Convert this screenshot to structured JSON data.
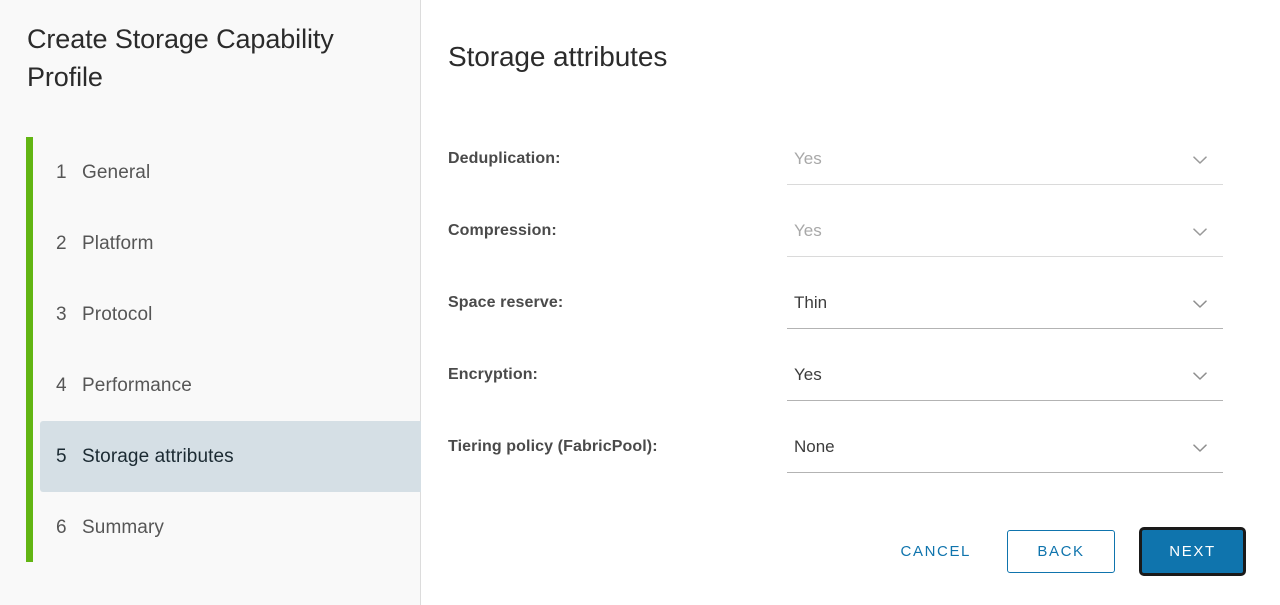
{
  "wizard": {
    "title": "Create Storage Capability Profile",
    "accent_color": "#62b513",
    "active_step_bg": "#d5dfe5",
    "steps": [
      {
        "num": "1",
        "label": "General",
        "active": false
      },
      {
        "num": "2",
        "label": "Platform",
        "active": false
      },
      {
        "num": "3",
        "label": "Protocol",
        "active": false
      },
      {
        "num": "4",
        "label": "Performance",
        "active": false
      },
      {
        "num": "5",
        "label": "Storage attributes",
        "active": true
      },
      {
        "num": "6",
        "label": "Summary",
        "active": false
      }
    ]
  },
  "page": {
    "title": "Storage attributes"
  },
  "form": {
    "fields": [
      {
        "label": "Deduplication:",
        "value": "Yes",
        "disabled": true,
        "icon": "chevron-down-icon"
      },
      {
        "label": "Compression:",
        "value": "Yes",
        "disabled": true,
        "icon": "chevron-down-icon"
      },
      {
        "label": "Space reserve:",
        "value": "Thin",
        "disabled": false,
        "icon": "chevron-down-icon"
      },
      {
        "label": "Encryption:",
        "value": "Yes",
        "disabled": false,
        "icon": "chevron-down-icon"
      },
      {
        "label": "Tiering policy (FabricPool):",
        "value": "None",
        "disabled": false,
        "icon": "chevron-down-icon"
      }
    ]
  },
  "footer": {
    "cancel_label": "CANCEL",
    "back_label": "BACK",
    "next_label": "NEXT",
    "primary_color": "#0f74ad",
    "link_color": "#0f74ad"
  }
}
